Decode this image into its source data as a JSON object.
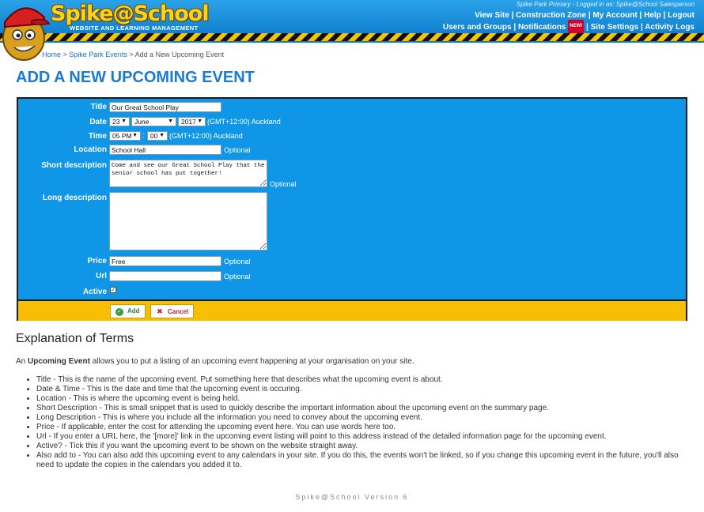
{
  "header": {
    "logo_text": "Spike@School",
    "logo_subtitle": "WEBSITE AND LEARNING MANAGEMENT",
    "logged_in_text": "Spike Park Primary - Logged in as: Spike@School Salesperson",
    "nav_row1": [
      "View Site",
      "Construction Zone",
      "My Account",
      "Help",
      "Logout"
    ],
    "nav_row2": [
      "Users and Groups",
      "Notifications",
      "Site Settings",
      "Activity Logs"
    ],
    "new_badge": "NEW!",
    "separator": " | "
  },
  "breadcrumb": {
    "home": "Home",
    "section": "Spike Park Events",
    "current": "Add a New Upcoming Event",
    "sep": " > "
  },
  "page_title": "ADD A NEW UPCOMING EVENT",
  "form": {
    "title_label": "Title",
    "title_value": "Our Great School Play",
    "date_label": "Date",
    "date_day": "23",
    "date_month": "June",
    "date_year": "2017",
    "date_timezone": "(GMT+12:00) Auckland",
    "time_label": "Time",
    "time_hour": "05 PM",
    "time_sep": ":",
    "time_minute": "00",
    "time_timezone": "(GMT+12:00) Auckland",
    "location_label": "Location",
    "location_value": "School Hall",
    "short_desc_label": "Short description",
    "short_desc_value": "Come and see our Great School Play that the senior school has put together!",
    "long_desc_label": "Long description",
    "long_desc_value": "",
    "price_label": "Price",
    "price_value": "Free",
    "url_label": "Url",
    "url_value": "",
    "active_label": "Active",
    "active_checked": true,
    "optional_text": "Optional",
    "add_button": "Add",
    "cancel_button": "Cancel"
  },
  "explanation": {
    "title": "Explanation of Terms",
    "intro_prefix": "An ",
    "intro_bold": "Upcoming Event",
    "intro_suffix": " allows you to put a listing of an upcoming event happening at your organisation on your site.",
    "items": [
      "Title - This is the name of the upcoming event. Put something here that describes what the upcoming event is about.",
      "Date & Time - This is the date and time that the upcoming event is occuring.",
      "Location - This is where the upcoming event is being held.",
      "Short Description - This is small snippet that is used to quickly describe the important information about the upcoming event on the summary page.",
      "Long Description - This is where you include all the information you need to convey about the upcoming event.",
      "Price - If applicable, enter the cost for attending the upcoming event here. You can use words here too.",
      "Url - If you enter a URL here, the '[more]' link in the upcoming event listing will point to this address instead of the detailed information page for the upcoming event.",
      "Active? - Tick this if you want the upcoming event to be shown on the website straight away.",
      "Also add to - You can also add this upcoming event to any calendars in your site. If you do this, the events won't be linked, so if you change this upcoming event in the future, you'll also need to update the copies in the calendars you added it to."
    ]
  },
  "footer": "Spike@School Version 6",
  "colors": {
    "header_blue": "#0a78c8",
    "form_blue": "#0f96e6",
    "form_footer_yellow": "#f8be04",
    "title_blue": "#1a7bd0",
    "logo_yellow": "#ffd21a"
  },
  "icons": {
    "mascot": "spike-mascot-icon",
    "add": "check-circle-icon",
    "cancel": "x-icon",
    "dropdown": "triangle-down-icon"
  }
}
